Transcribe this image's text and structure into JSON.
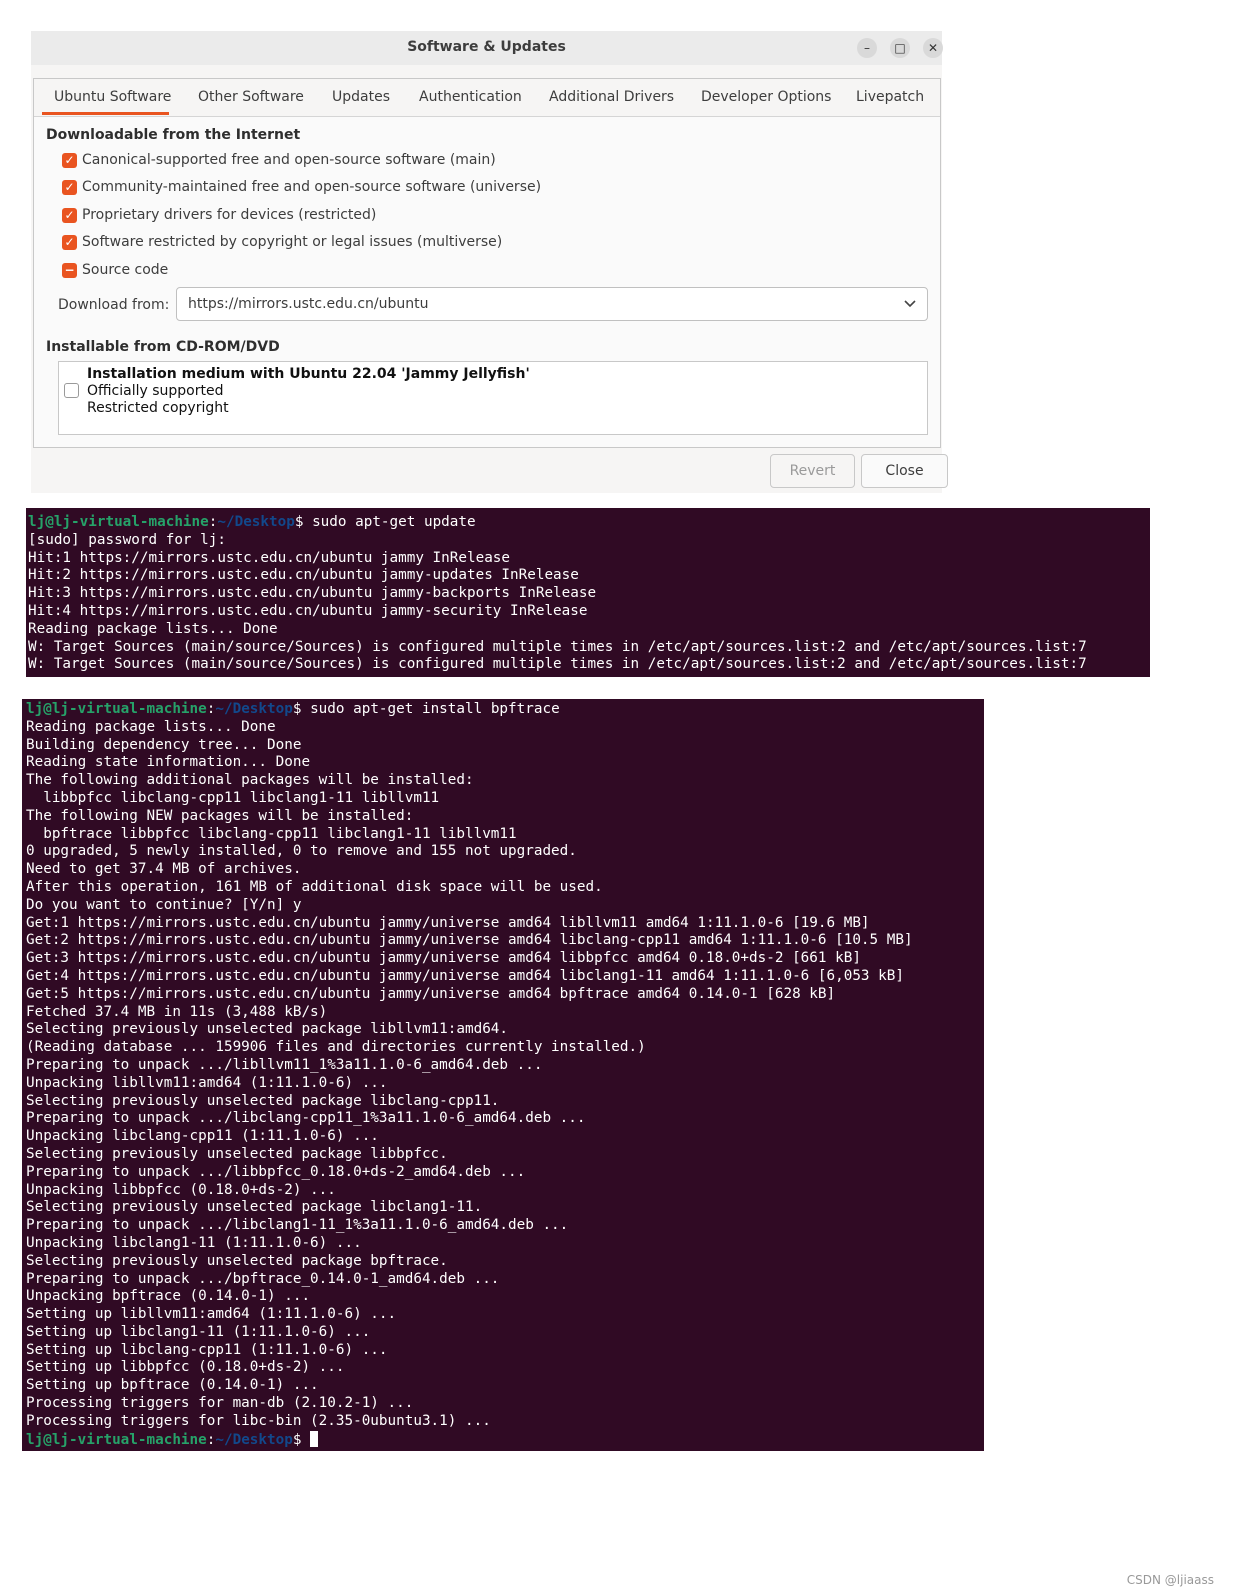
{
  "window": {
    "title": "Software & Updates",
    "controls": {
      "minimize": "–",
      "maximize": "□",
      "close": "✕"
    },
    "tabs": [
      "Ubuntu Software",
      "Other Software",
      "Updates",
      "Authentication",
      "Additional Drivers",
      "Developer Options",
      "Livepatch"
    ],
    "active_tab": "Ubuntu Software",
    "accent_color": "#e95420",
    "internet_section": {
      "heading": "Downloadable from the Internet",
      "checkboxes": [
        {
          "label": "Canonical-supported free and open-source software (main)",
          "state": "checked"
        },
        {
          "label": "Community-maintained free and open-source software (universe)",
          "state": "checked"
        },
        {
          "label": "Proprietary drivers for devices (restricted)",
          "state": "checked"
        },
        {
          "label": "Software restricted by copyright or legal issues (multiverse)",
          "state": "checked"
        },
        {
          "label": "Source code",
          "state": "mixed"
        }
      ],
      "download_label": "Download from:",
      "download_value": "https://mirrors.ustc.edu.cn/ubuntu"
    },
    "cdrom_section": {
      "heading": "Installable from CD-ROM/DVD",
      "item_title": "Installation medium with Ubuntu 22.04 'Jammy Jellyfish'",
      "item_line1": "Officially supported",
      "item_line2": "Restricted copyright",
      "checked": false
    },
    "buttons": {
      "revert": "Revert",
      "close": "Close"
    }
  },
  "terminal1": {
    "prompt_user": "lj@lj-virtual-machine",
    "prompt_path": "~/Desktop",
    "command": "sudo apt-get update",
    "lines": [
      "[sudo] password for lj:",
      "Hit:1 https://mirrors.ustc.edu.cn/ubuntu jammy InRelease",
      "Hit:2 https://mirrors.ustc.edu.cn/ubuntu jammy-updates InRelease",
      "Hit:3 https://mirrors.ustc.edu.cn/ubuntu jammy-backports InRelease",
      "Hit:4 https://mirrors.ustc.edu.cn/ubuntu jammy-security InRelease",
      "Reading package lists... Done",
      "W: Target Sources (main/source/Sources) is configured multiple times in /etc/apt/sources.list:2 and /etc/apt/sources.list:7",
      "W: Target Sources (main/source/Sources) is configured multiple times in /etc/apt/sources.list:2 and /etc/apt/sources.list:7"
    ]
  },
  "terminal2": {
    "prompt_user": "lj@lj-virtual-machine",
    "prompt_path": "~/Desktop",
    "command": "sudo apt-get install bpftrace",
    "lines": [
      "Reading package lists... Done",
      "Building dependency tree... Done",
      "Reading state information... Done",
      "The following additional packages will be installed:",
      "  libbpfcc libclang-cpp11 libclang1-11 libllvm11",
      "The following NEW packages will be installed:",
      "  bpftrace libbpfcc libclang-cpp11 libclang1-11 libllvm11",
      "0 upgraded, 5 newly installed, 0 to remove and 155 not upgraded.",
      "Need to get 37.4 MB of archives.",
      "After this operation, 161 MB of additional disk space will be used.",
      "Do you want to continue? [Y/n] y",
      "Get:1 https://mirrors.ustc.edu.cn/ubuntu jammy/universe amd64 libllvm11 amd64 1:11.1.0-6 [19.6 MB]",
      "Get:2 https://mirrors.ustc.edu.cn/ubuntu jammy/universe amd64 libclang-cpp11 amd64 1:11.1.0-6 [10.5 MB]",
      "Get:3 https://mirrors.ustc.edu.cn/ubuntu jammy/universe amd64 libbpfcc amd64 0.18.0+ds-2 [661 kB]",
      "Get:4 https://mirrors.ustc.edu.cn/ubuntu jammy/universe amd64 libclang1-11 amd64 1:11.1.0-6 [6,053 kB]",
      "Get:5 https://mirrors.ustc.edu.cn/ubuntu jammy/universe amd64 bpftrace amd64 0.14.0-1 [628 kB]",
      "Fetched 37.4 MB in 11s (3,488 kB/s)",
      "Selecting previously unselected package libllvm11:amd64.",
      "(Reading database ... 159906 files and directories currently installed.)",
      "Preparing to unpack .../libllvm11_1%3a11.1.0-6_amd64.deb ...",
      "Unpacking libllvm11:amd64 (1:11.1.0-6) ...",
      "Selecting previously unselected package libclang-cpp11.",
      "Preparing to unpack .../libclang-cpp11_1%3a11.1.0-6_amd64.deb ...",
      "Unpacking libclang-cpp11 (1:11.1.0-6) ...",
      "Selecting previously unselected package libbpfcc.",
      "Preparing to unpack .../libbpfcc_0.18.0+ds-2_amd64.deb ...",
      "Unpacking libbpfcc (0.18.0+ds-2) ...",
      "Selecting previously unselected package libclang1-11.",
      "Preparing to unpack .../libclang1-11_1%3a11.1.0-6_amd64.deb ...",
      "Unpacking libclang1-11 (1:11.1.0-6) ...",
      "Selecting previously unselected package bpftrace.",
      "Preparing to unpack .../bpftrace_0.14.0-1_amd64.deb ...",
      "Unpacking bpftrace (0.14.0-1) ...",
      "Setting up libllvm11:amd64 (1:11.1.0-6) ...",
      "Setting up libclang1-11 (1:11.1.0-6) ...",
      "Setting up libclang-cpp11 (1:11.1.0-6) ...",
      "Setting up libbpfcc (0.18.0+ds-2) ...",
      "Setting up bpftrace (0.14.0-1) ...",
      "Processing triggers for man-db (2.10.2-1) ...",
      "Processing triggers for libc-bin (2.35-0ubuntu3.1) ..."
    ],
    "final_prompt_user": "lj@lj-virtual-machine",
    "final_prompt_path": "~/Desktop"
  },
  "colors": {
    "terminal_bg": "#300a24",
    "prompt_user": "#26a269",
    "prompt_path": "#12488b"
  },
  "watermark": "CSDN @ljiaass"
}
